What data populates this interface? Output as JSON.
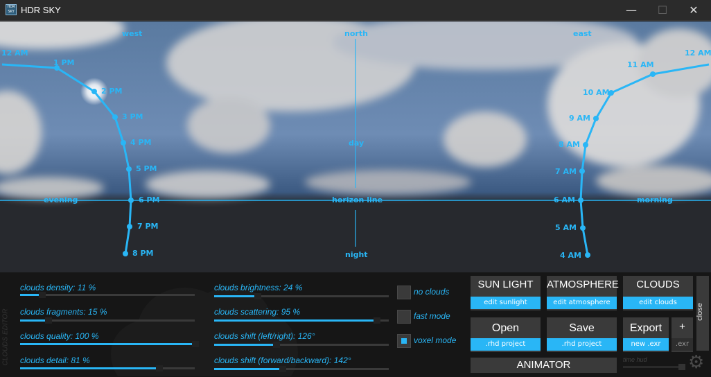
{
  "window": {
    "title": "HDR SKY",
    "icon_text_top": "HDR",
    "icon_text_bottom": "SKY",
    "minimize": "—",
    "maximize": "☐",
    "close": "✕"
  },
  "sky": {
    "directions": {
      "west": "west",
      "north": "north",
      "east": "east",
      "day": "day",
      "horizon": "horizon line",
      "night": "night",
      "evening": "evening",
      "morning": "morning"
    },
    "afternoon_hours": [
      "12 AM",
      "1 PM",
      "2 PM",
      "3 PM",
      "4 PM",
      "5 PM",
      "6 PM",
      "7 PM",
      "8 PM"
    ],
    "morning_hours": [
      "12 AM",
      "11 AM",
      "10 AM",
      "9 AM",
      "8 AM",
      "7 AM",
      "6 AM",
      "5 AM",
      "4 AM"
    ]
  },
  "editor": {
    "tag": "CLOUDS EDITOR",
    "sliders_left": [
      {
        "label": "clouds density: 11 %",
        "value": 0.11
      },
      {
        "label": "clouds fragments: 15 %",
        "value": 0.15
      },
      {
        "label": "clouds quality: 100 %",
        "value": 1.0
      },
      {
        "label": "clouds detail: 81 %",
        "value": 0.81
      }
    ],
    "sliders_right": [
      {
        "label": "clouds brightness: 24 %",
        "value": 0.24
      },
      {
        "label": "clouds scattering: 95 %",
        "value": 0.95
      },
      {
        "label": "clouds shift (left/right): 126°",
        "value": 0.35
      },
      {
        "label": "clouds shift (forward/backward): 142°",
        "value": 0.39
      }
    ],
    "checks": [
      {
        "label": "no clouds",
        "on": false
      },
      {
        "label": "fast mode",
        "on": false
      },
      {
        "label": "voxel mode",
        "on": true
      }
    ]
  },
  "buttons": {
    "sunlight": {
      "main": "SUN LIGHT",
      "sub": "edit sunlight"
    },
    "atmosphere": {
      "main": "ATMOSPHERE",
      "sub": "edit atmosphere"
    },
    "clouds": {
      "main": "CLOUDS",
      "sub": "edit clouds"
    },
    "open": {
      "main": "Open",
      "sub": ".rhd project"
    },
    "save": {
      "main": "Save",
      "sub": ".rhd project"
    },
    "export": {
      "main": "Export",
      "sub": "new .exr"
    },
    "plus": {
      "main": "+",
      "sub": ".exr"
    },
    "close": "close",
    "animator": "ANIMATOR",
    "time_hud": "time hud"
  },
  "colors": {
    "accent": "#29b6f6",
    "panel": "#161616",
    "button": "#3a3a3a"
  },
  "icons": {
    "settings": "gear-icon"
  }
}
